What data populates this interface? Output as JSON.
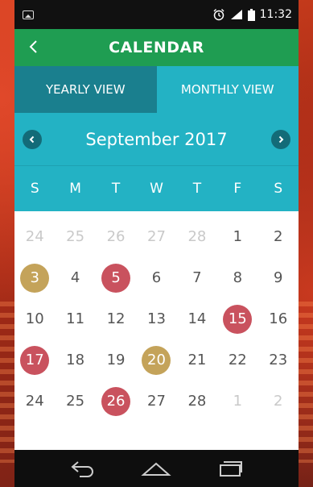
{
  "status_bar": {
    "time": "11:32"
  },
  "app_bar": {
    "title": "CALENDAR"
  },
  "tabs": [
    {
      "label": "YEARLY VIEW"
    },
    {
      "label": "MONTHLY VIEW"
    }
  ],
  "month_nav": {
    "label": "September 2017"
  },
  "weekdays": [
    "S",
    "M",
    "T",
    "W",
    "T",
    "F",
    "S"
  ],
  "weeks": [
    [
      {
        "d": "24",
        "s": "muted"
      },
      {
        "d": "25",
        "s": "muted"
      },
      {
        "d": "26",
        "s": "muted"
      },
      {
        "d": "27",
        "s": "muted"
      },
      {
        "d": "28",
        "s": "muted"
      },
      {
        "d": "1",
        "s": "normal"
      },
      {
        "d": "2",
        "s": "normal"
      }
    ],
    [
      {
        "d": "3",
        "s": "gold"
      },
      {
        "d": "4",
        "s": "normal"
      },
      {
        "d": "5",
        "s": "red"
      },
      {
        "d": "6",
        "s": "normal"
      },
      {
        "d": "7",
        "s": "normal"
      },
      {
        "d": "8",
        "s": "normal"
      },
      {
        "d": "9",
        "s": "normal"
      }
    ],
    [
      {
        "d": "10",
        "s": "normal"
      },
      {
        "d": "11",
        "s": "normal"
      },
      {
        "d": "12",
        "s": "normal"
      },
      {
        "d": "13",
        "s": "normal"
      },
      {
        "d": "14",
        "s": "normal"
      },
      {
        "d": "15",
        "s": "red"
      },
      {
        "d": "16",
        "s": "normal"
      }
    ],
    [
      {
        "d": "17",
        "s": "red"
      },
      {
        "d": "18",
        "s": "normal"
      },
      {
        "d": "19",
        "s": "normal"
      },
      {
        "d": "20",
        "s": "gold"
      },
      {
        "d": "21",
        "s": "normal"
      },
      {
        "d": "22",
        "s": "normal"
      },
      {
        "d": "23",
        "s": "normal"
      }
    ],
    [
      {
        "d": "24",
        "s": "normal"
      },
      {
        "d": "25",
        "s": "normal"
      },
      {
        "d": "26",
        "s": "red"
      },
      {
        "d": "27",
        "s": "normal"
      },
      {
        "d": "28",
        "s": "normal"
      },
      {
        "d": "1",
        "s": "muted"
      },
      {
        "d": "2",
        "s": "muted"
      }
    ]
  ],
  "colors": {
    "app_bar": "#1f9d52",
    "header_teal": "#23b2c4",
    "active_tab": "#1a7f8e",
    "event_red": "#c9525e",
    "event_gold": "#c4a35a"
  },
  "icons": {
    "status_left": "image-icon",
    "status_right": [
      "alarm-icon",
      "signal-icon",
      "battery-icon"
    ],
    "app_bar_back": "chevron-left-icon",
    "prev_month": "chevron-left-circle-icon",
    "next_month": "chevron-right-circle-icon",
    "nav": [
      "back-icon",
      "home-icon",
      "recents-icon"
    ]
  }
}
